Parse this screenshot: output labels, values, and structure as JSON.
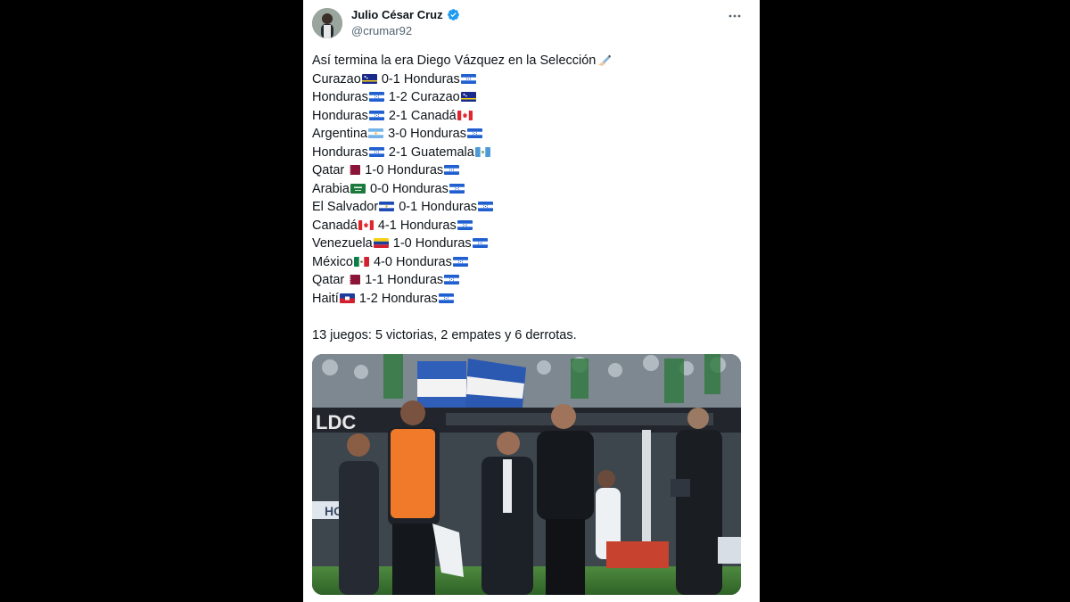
{
  "author": {
    "name": "Julio César Cruz",
    "handle": "@crumar92",
    "verified": true
  },
  "tweet": {
    "intro": "Así termina la era Diego Vázquez en la Selección",
    "results": [
      {
        "home": "Curazao",
        "home_flag": "curacao",
        "score": "0-1",
        "away": "Honduras",
        "away_flag": "honduras"
      },
      {
        "home": "Honduras",
        "home_flag": "honduras",
        "score": "1-2",
        "away": "Curazao",
        "away_flag": "curacao"
      },
      {
        "home": "Honduras",
        "home_flag": "honduras",
        "score": "2-1",
        "away": "Canadá",
        "away_flag": "canada"
      },
      {
        "home": "Argentina",
        "home_flag": "argentina",
        "score": "3-0",
        "away": "Honduras",
        "away_flag": "honduras"
      },
      {
        "home": "Honduras",
        "home_flag": "honduras",
        "score": "2-1",
        "away": "Guatemala",
        "away_flag": "guatemala"
      },
      {
        "home": "Qatar",
        "home_flag": "qatar",
        "score": "1-0",
        "away": "Honduras",
        "away_flag": "honduras"
      },
      {
        "home": "Arabia",
        "home_flag": "saudi",
        "score": "0-0",
        "away": "Honduras",
        "away_flag": "honduras"
      },
      {
        "home": "El Salvador",
        "home_flag": "elsalvador",
        "score": "0-1",
        "away": "Honduras",
        "away_flag": "honduras"
      },
      {
        "home": "Canadá",
        "home_flag": "canada",
        "score": "4-1",
        "away": "Honduras",
        "away_flag": "honduras"
      },
      {
        "home": "Venezuela",
        "home_flag": "venezuela",
        "score": "1-0",
        "away": "Honduras",
        "away_flag": "honduras"
      },
      {
        "home": "México",
        "home_flag": "mexico",
        "score": "4-0",
        "away": "Honduras",
        "away_flag": "honduras"
      },
      {
        "home": "Qatar",
        "home_flag": "qatar",
        "score": "1-1",
        "away": "Honduras",
        "away_flag": "honduras"
      },
      {
        "home": "Haití",
        "home_flag": "haiti",
        "score": "1-2",
        "away": "Honduras",
        "away_flag": "honduras"
      }
    ],
    "summary": "13 juegos: 5 victorias, 2 empates y 6 derrotas."
  },
  "media": {
    "sign_text": "HO",
    "banner_text": "LDC"
  },
  "icons": {
    "more": "more-options-icon",
    "verified": "verified-badge-icon",
    "pen": "writing-hand-icon"
  },
  "colors": {
    "verified": "#1d9bf0",
    "text": "#0f1419",
    "muted": "#536471"
  }
}
